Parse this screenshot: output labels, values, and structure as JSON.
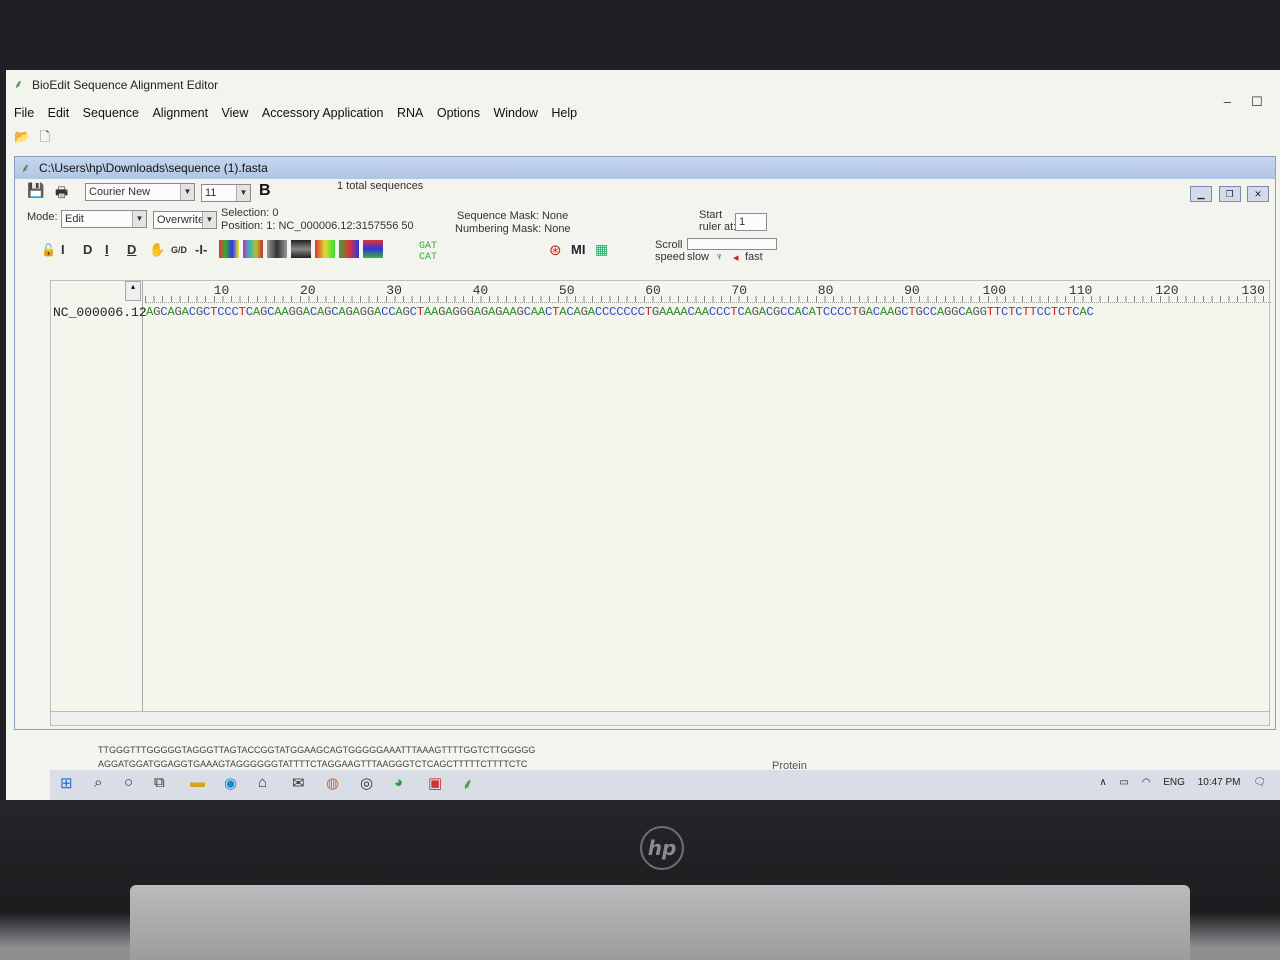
{
  "app": {
    "title": "BioEdit Sequence Alignment Editor",
    "menu": [
      "File",
      "Edit",
      "Sequence",
      "Alignment",
      "View",
      "Accessory Application",
      "RNA",
      "Options",
      "Window",
      "Help"
    ]
  },
  "doc": {
    "title": "C:\\Users\\hp\\Downloads\\sequence (1).fasta",
    "font": "Courier New",
    "font_size": "11",
    "bold_label": "B",
    "total": "1 total sequences",
    "mode_label": "Mode:",
    "mode": "Edit",
    "overwrite": "Overwrite",
    "selection": "Selection: 0",
    "position": "Position:  1: NC_000006.12:3157556 50",
    "seq_mask": "Sequence Mask: None",
    "num_mask": "Numbering Mask: None",
    "start_label_1": "Start",
    "start_label_2": "ruler at:",
    "start_value": "1",
    "scroll_label_1": "Scroll",
    "scroll_label_2": "speed",
    "slow": "slow",
    "fast": "fast"
  },
  "alignment": {
    "name": "NC_000006.12",
    "ruler": [
      "10",
      "20",
      "30",
      "40",
      "50",
      "60",
      "70",
      "80",
      "90",
      "100",
      "110",
      "120",
      "130"
    ],
    "sequence": "AGCAGACGCTCCCTCAGCAAGGACAGCAGAGGACCAGCTAAGAGGGAGAGAAGCAACTACAGACCCCCCCTGAAAACAACCCTCAGACGCCACATCCCCTGACAAGCTGCCAGGCAGGTTCTCTTCCTCTCAC"
  },
  "background": {
    "line1": "TTGGGTTTGGGGGTAGGGTTAGTACCGGTATGGAAGCAGTGGGGGAAATTTAAAGTTTTGGTCTTGGGGG",
    "line2": "AGGATGGATGGAGGTGAAAGTAGGGGGGTATTTTCTAGGAAGTTTAAGGGTCTCAGCTTTTTCTTTTCTC",
    "protein": "Protein"
  },
  "taskbar": {
    "lang": "ENG",
    "time": "10:47 PM"
  },
  "colors": {
    "A": "#2e8b2e",
    "C": "#2f49c9",
    "G": "#555555",
    "T": "#c8282a"
  }
}
